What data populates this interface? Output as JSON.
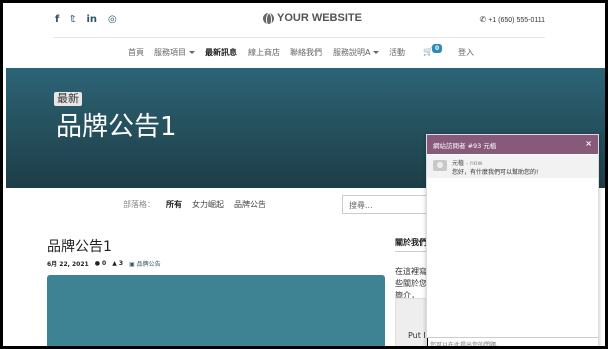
{
  "header": {
    "social": [
      "f",
      "𝕥",
      "in",
      "◎"
    ],
    "logo": "YOUR WEBSITE",
    "phone": "+1 (650) 555-0111"
  },
  "nav": {
    "items": [
      "首頁",
      "服務項目",
      "最新訊息",
      "線上商店",
      "聯絡我們",
      "服務說明A",
      "活動"
    ],
    "active": "最新訊息",
    "cart_count": "0",
    "login": "登入"
  },
  "hero": {
    "tag": "最新",
    "title": "品牌公告1"
  },
  "filter": {
    "label": "部落格：",
    "options": [
      "所有",
      "女力崛起",
      "品牌公告"
    ],
    "search_placeholder": "搜尋..."
  },
  "post": {
    "title": "品牌公告1",
    "date": "6月 22, 2021",
    "comments": "0",
    "views": "3",
    "category": "品牌公告"
  },
  "sidebar": {
    "title": "關於我們",
    "text": "在這裡寫一些關於您的簡介，",
    "box_text": "Put I"
  },
  "chat": {
    "title": "網站訪問者 #93 元植",
    "close": "×",
    "sender": "元植",
    "time": " - now",
    "message": "您好，有什麼我們可以幫助您的!",
    "input_placeholder": "您可以在此提出您的問題。"
  },
  "colors": {
    "primary": "#2b5466",
    "hero": "#26525f",
    "chat_header": "#875a7b"
  }
}
